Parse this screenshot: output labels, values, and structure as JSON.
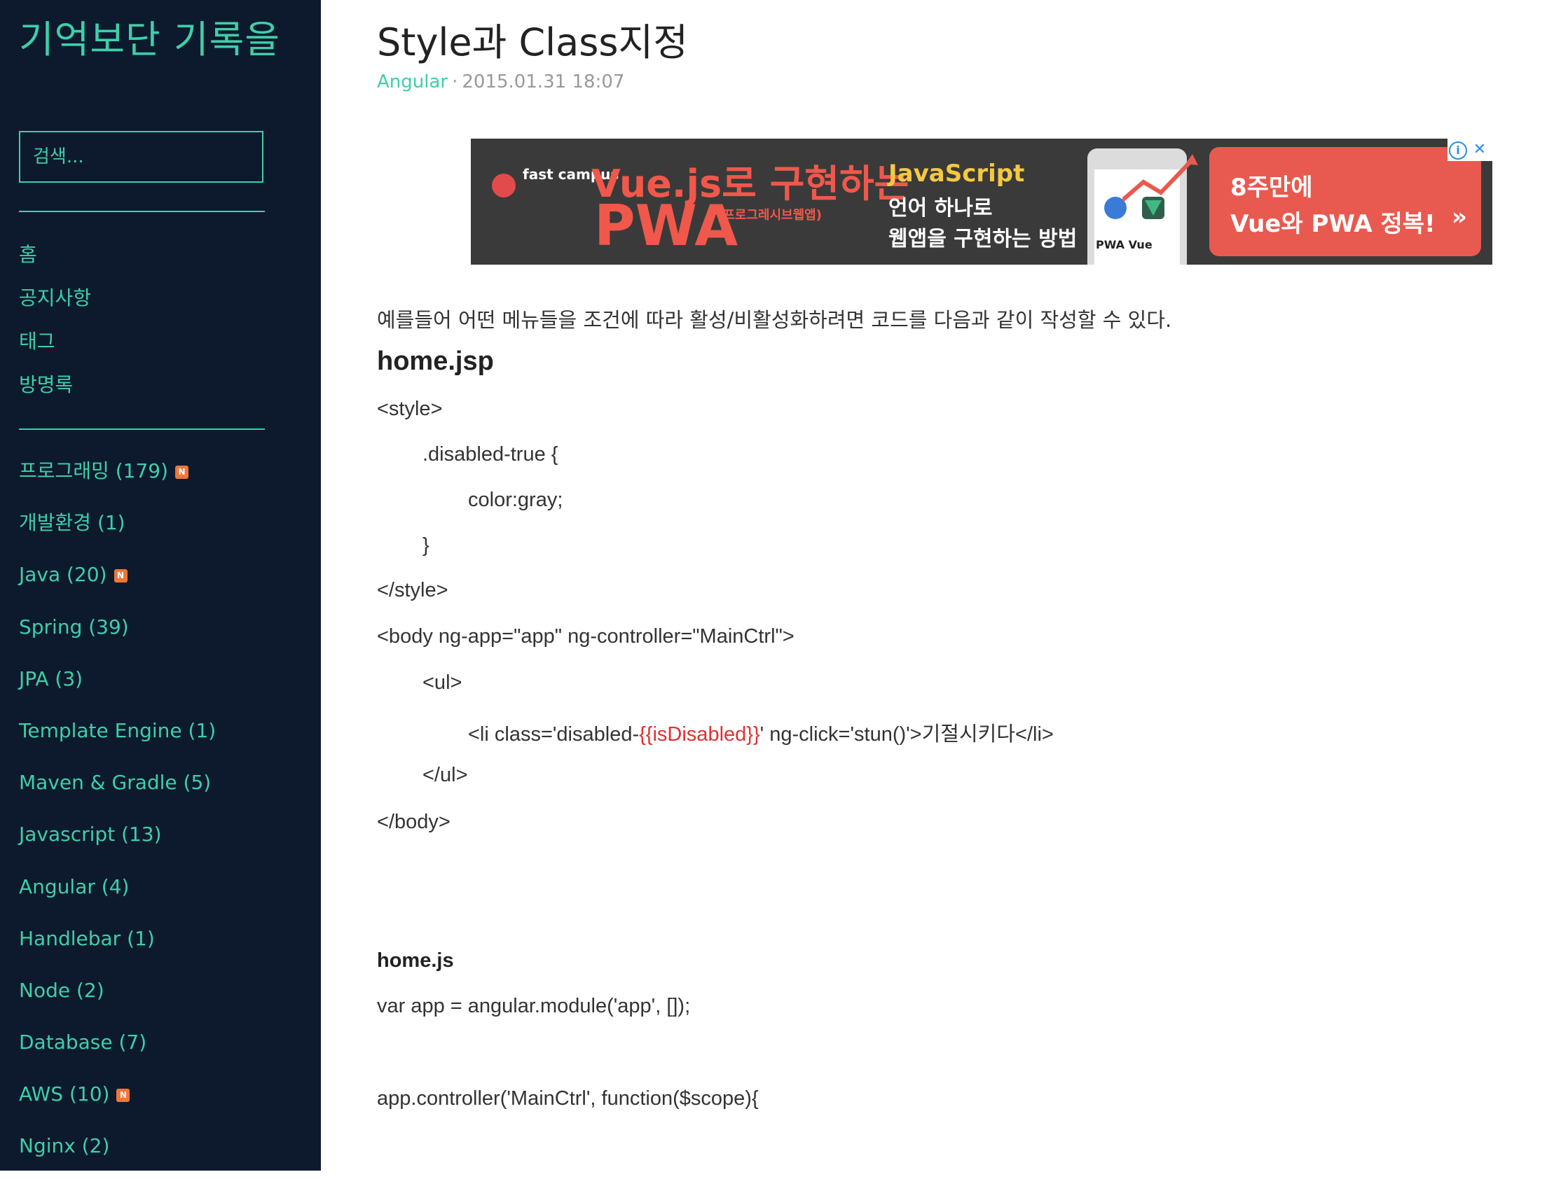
{
  "sidebar": {
    "blog_title": "기억보단 기록을",
    "search_placeholder": "검색...",
    "nav": [
      "홈",
      "공지사항",
      "태그",
      "방명록"
    ],
    "categories": [
      {
        "label": "프로그래밍 (179)",
        "new": true
      },
      {
        "label": "개발환경 (1)",
        "new": false
      },
      {
        "label": "Java (20)",
        "new": true
      },
      {
        "label": "Spring (39)",
        "new": false
      },
      {
        "label": "JPA (3)",
        "new": false
      },
      {
        "label": "Template Engine (1)",
        "new": false
      },
      {
        "label": "Maven & Gradle (5)",
        "new": false
      },
      {
        "label": "Javascript (13)",
        "new": false
      },
      {
        "label": "Angular (4)",
        "new": false
      },
      {
        "label": "Handlebar (1)",
        "new": false
      },
      {
        "label": "Node (2)",
        "new": false
      },
      {
        "label": "Database (7)",
        "new": false
      },
      {
        "label": "AWS (10)",
        "new": true
      },
      {
        "label": "Nginx (2)",
        "new": false
      }
    ],
    "new_badge": "N"
  },
  "post": {
    "title": "Style과 Class지정",
    "category": "Angular",
    "separator": "·",
    "date": "2015.01.31 18:07",
    "intro": "예를들어 어떤 메뉴들을 조건에 따라 활성/비활성화하려면 코드를 다음과 같이 작성할 수 있다.",
    "heading_jsp": "home.jsp",
    "jsp_lines": {
      "l1": "<style>",
      "l2": ".disabled-true {",
      "l3": "color:gray;",
      "l4": "}",
      "l5": "</style>",
      "l6": "<body ng-app=\"app\"  ng-controller=\"MainCtrl\">",
      "l7": "<ul>",
      "l8_pre": "<li class='disabled-",
      "l8_hl": "{{isDisabled}}",
      "l8_post": "' ng-click='stun()'>기절시키다</li>",
      "l9": "</ul>",
      "l10": "</body>"
    },
    "heading_js": "home.js",
    "js_lines": {
      "l1": "var app = angular.module('app', []);",
      "l2": "app.controller('MainCtrl', function($scope){"
    }
  },
  "ad": {
    "logo": "fast campus",
    "headline": "Vue.js로 구현하는",
    "big": "PWA",
    "big_sub": "(프로그레시브웹앱)",
    "js": "JavaScript",
    "desc1": "언어 하나로",
    "desc2": "웹앱을 구현하는 방법",
    "phone_label": "PWA  Vue",
    "cta1": "8주만에",
    "cta2": "Vue와 PWA 정복!",
    "cta_arrow": "»",
    "info": "i",
    "close": "✕"
  },
  "colors": {
    "sidebar_bg": "#0d1a2e",
    "accent": "#3ecfa8",
    "highlight_red": "#e0302f",
    "badge_orange": "#f0763a"
  }
}
